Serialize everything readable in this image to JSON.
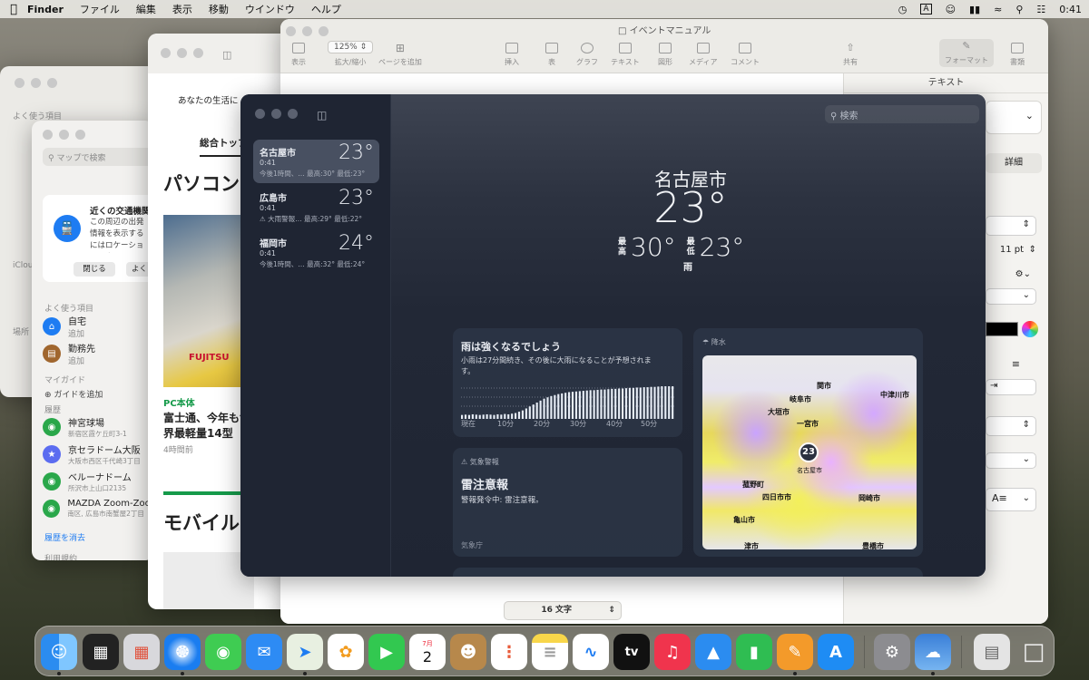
{
  "menubar": {
    "app": "Finder",
    "items": [
      "ファイル",
      "編集",
      "表示",
      "移動",
      "ウインドウ",
      "ヘルプ"
    ],
    "time": "0:41"
  },
  "pages": {
    "title": "イベントマニュアル",
    "zoom": "125%",
    "toolbar": [
      "表示",
      "拡大/縮小",
      "ページを追加",
      "挿入",
      "表",
      "グラフ",
      "テキスト",
      "図形",
      "メディア",
      "コメント",
      "共有",
      "フォーマット",
      "書類"
    ],
    "inspector": {
      "header": "テキスト",
      "detail_btn": "詳細",
      "font_size": "11 pt"
    },
    "wordcount": "16 文字"
  },
  "browser": {
    "tagline": "あなたの生活に",
    "tab": "総合トップ",
    "heading1": "パソコン",
    "category": "PC本体",
    "news_title": "富士通、今年も世界最軽量14型",
    "news_time": "4時間前",
    "heading2": "モバイル",
    "logo_text": "FUJITSU"
  },
  "maps": {
    "search_placeholder": "マップで検索",
    "transit_title": "近くの交通機関",
    "transit_body": "この周辺の出発情報を表示するにはロケーションに素早くアクセスできます。",
    "close_btn": "閉じる",
    "more_btn": "よく",
    "favorites_header": "よく使う項目",
    "favorites": [
      {
        "name": "自宅",
        "sub": "追加"
      },
      {
        "name": "勤務先",
        "sub": "追加"
      }
    ],
    "guides_header": "マイガイド",
    "add_guide": "ガイドを追加",
    "history_header": "履歴",
    "history": [
      {
        "name": "神宮球場",
        "sub": "新宿区霞ケ丘町3-1"
      },
      {
        "name": "京セラドーム大阪",
        "sub": "大阪市西区千代崎3丁目"
      },
      {
        "name": "ベルーナドーム",
        "sub": "所沢市上山口2135"
      },
      {
        "name": "MAZDA Zoom-Zoom",
        "sub": "南区, 広島市南蟹屋2丁目"
      }
    ],
    "clear_history": "履歴を消去",
    "terms": "利用規約"
  },
  "finder_sidebar": {
    "favorites": "よく使う項目",
    "icloud": "iCloud",
    "locations": "場所"
  },
  "weather": {
    "search_placeholder": "検索",
    "cities": [
      {
        "name": "名古屋市",
        "time": "0:41",
        "temp": "23°",
        "sub": "今後1時間、…  最高:30°  最低:23°"
      },
      {
        "name": "広島市",
        "time": "0:41",
        "temp": "23°",
        "sub": "⚠ 大雨警報…  最高:29°  最低:22°"
      },
      {
        "name": "福岡市",
        "time": "0:41",
        "temp": "24°",
        "sub": "今後1時間、…  最高:32°  最低:24°"
      }
    ],
    "main": {
      "city": "名古屋市",
      "temp": "23°",
      "high_label": "最高",
      "high": "30°",
      "low_label": "最低",
      "low": "23°",
      "condition": "雨"
    },
    "rain_card": {
      "title": "雨は強くなるでしょう",
      "body": "小雨は27分間続き、その後に大雨になることが予想されます。",
      "axis": [
        "現在",
        "10分",
        "20分",
        "30分",
        "40分",
        "50分"
      ]
    },
    "alert_card": {
      "header": "気象警報",
      "title": "雷注意報",
      "body": "警報発令中: 雷注意報。",
      "source": "気象庁"
    },
    "map_card": {
      "header": "降水",
      "labels": [
        "関市",
        "岐阜市",
        "中津川市",
        "大垣市",
        "一宮市",
        "名古屋市",
        "菰野町",
        "四日市市",
        "岡崎市",
        "亀山市",
        "津市",
        "豊橋市"
      ],
      "badge": "23"
    },
    "precip_minutes": [
      0.12,
      0.13,
      0.12,
      0.14,
      0.13,
      0.12,
      0.13,
      0.14,
      0.13,
      0.12,
      0.14,
      0.13,
      0.15,
      0.14,
      0.16,
      0.18,
      0.22,
      0.26,
      0.32,
      0.38,
      0.44,
      0.5,
      0.56,
      0.62,
      0.66,
      0.7,
      0.73,
      0.76,
      0.78,
      0.8,
      0.82,
      0.83,
      0.84,
      0.85,
      0.86,
      0.87,
      0.88,
      0.88,
      0.89,
      0.9,
      0.9,
      0.91,
      0.92,
      0.92,
      0.93,
      0.93,
      0.94,
      0.95,
      0.95,
      0.96,
      0.96,
      0.97,
      0.97,
      0.98,
      0.98,
      0.99,
      1,
      1,
      1,
      1
    ]
  },
  "dock": {
    "apps": [
      "Finder",
      "Mission Control",
      "Launchpad",
      "Safari",
      "メッセージ",
      "メール",
      "マップ",
      "写真",
      "FaceTime",
      "カレンダー",
      "連絡先",
      "リマインダー",
      "メモ",
      "フリーボード",
      "TV",
      "ミュージック",
      "Keynote",
      "Numbers",
      "Pages",
      "App Store",
      "システム設定",
      "天気",
      "書類",
      "ゴミ箱"
    ],
    "calendar_month": "7月",
    "calendar_day": "2"
  },
  "colors": {
    "weather_bg": "#1c2230",
    "accent_blue": "#1e7cf2",
    "menubar": "#ecebe6"
  }
}
